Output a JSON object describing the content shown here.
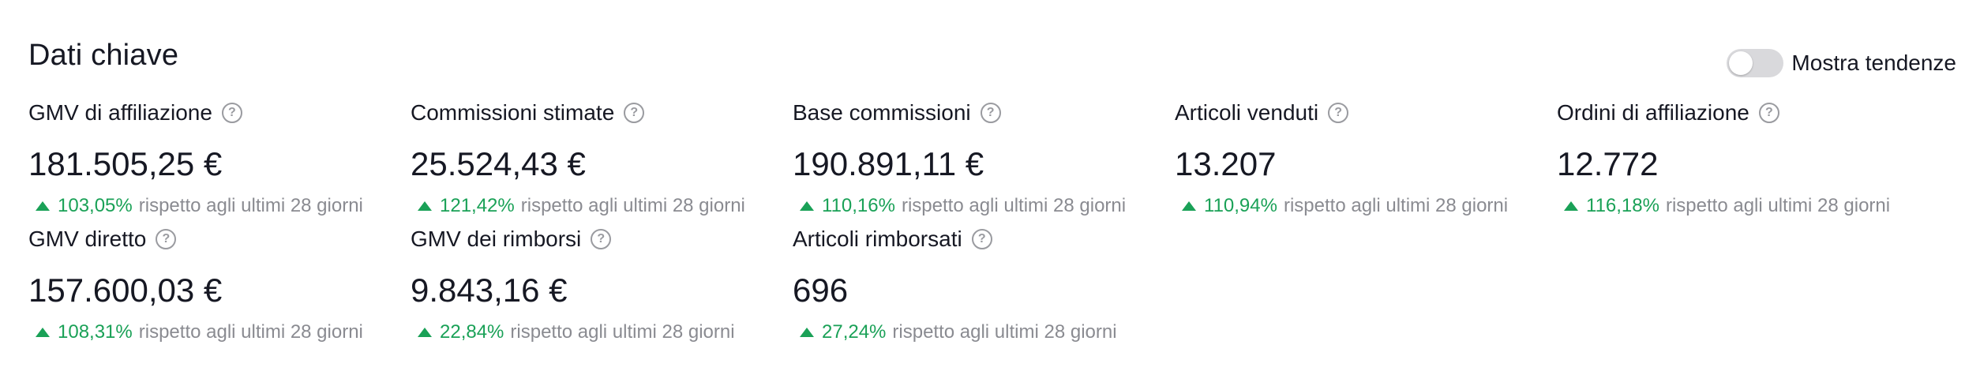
{
  "header": {
    "title": "Dati chiave",
    "toggle_label": "Mostra tendenze",
    "toggle_on": false
  },
  "colors": {
    "positive": "#1aa157",
    "text": "#161823",
    "muted": "#8a8b91",
    "toggle_off": "#d9d9dc"
  },
  "metrics": [
    {
      "label": "GMV di affiliazione",
      "value": "181.505,25 €",
      "change": "103,05%",
      "note": "rispetto agli ultimi 28 giorni"
    },
    {
      "label": "Commissioni stimate",
      "value": "25.524,43 €",
      "change": "121,42%",
      "note": "rispetto agli ultimi 28 giorni"
    },
    {
      "label": "Base commissioni",
      "value": "190.891,11 €",
      "change": "110,16%",
      "note": "rispetto agli ultimi 28 giorni"
    },
    {
      "label": "Articoli venduti",
      "value": "13.207",
      "change": "110,94%",
      "note": "rispetto agli ultimi 28 giorni"
    },
    {
      "label": "Ordini di affiliazione",
      "value": "12.772",
      "change": "116,18%",
      "note": "rispetto agli ultimi 28 giorni"
    },
    {
      "label": "GMV diretto",
      "value": "157.600,03 €",
      "change": "108,31%",
      "note": "rispetto agli ultimi 28 giorni"
    },
    {
      "label": "GMV dei rimborsi",
      "value": "9.843,16 €",
      "change": "22,84%",
      "note": "rispetto agli ultimi 28 giorni"
    },
    {
      "label": "Articoli rimborsati",
      "value": "696",
      "change": "27,24%",
      "note": "rispetto agli ultimi 28 giorni"
    }
  ]
}
